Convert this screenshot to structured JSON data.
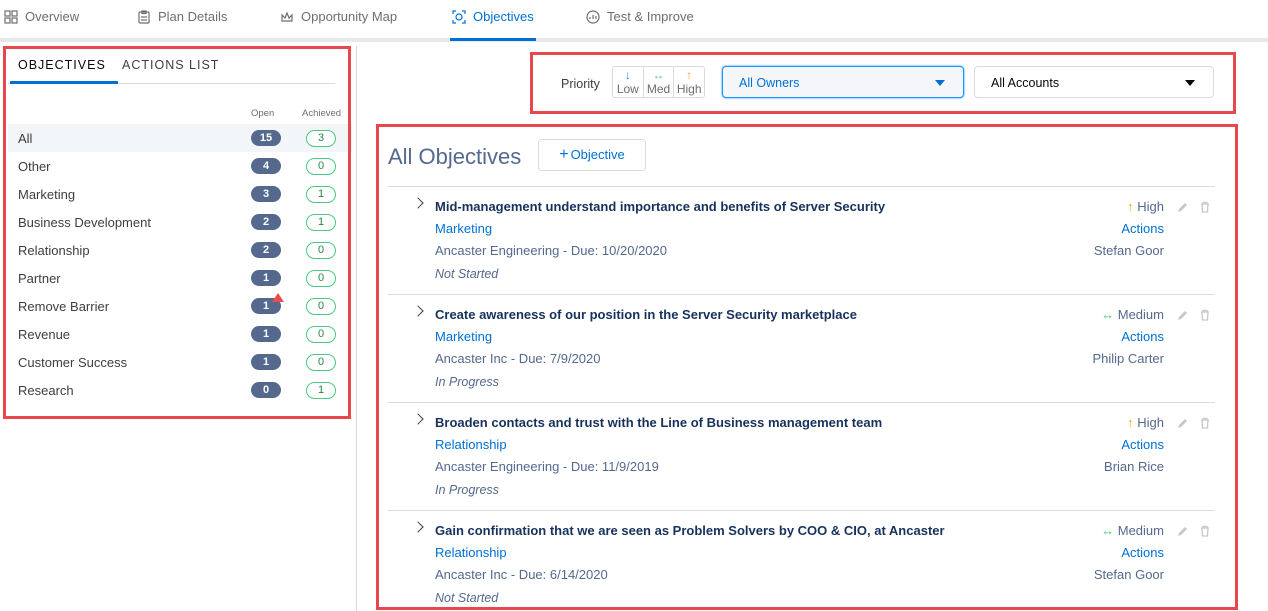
{
  "nav": {
    "tabs": [
      {
        "label": "Overview",
        "icon": "grid-icon"
      },
      {
        "label": "Plan Details",
        "icon": "clipboard-icon"
      },
      {
        "label": "Opportunity Map",
        "icon": "crown-icon"
      },
      {
        "label": "Objectives",
        "icon": "target-icon"
      },
      {
        "label": "Test & Improve",
        "icon": "gauge-icon"
      }
    ],
    "active_tab": "Objectives"
  },
  "sidebar": {
    "tabs": [
      "OBJECTIVES",
      "ACTIONS LIST"
    ],
    "active_tab": "OBJECTIVES",
    "col_open": "Open",
    "col_achieved": "Achieved",
    "categories": [
      {
        "label": "All",
        "open": "15",
        "achieved": "3"
      },
      {
        "label": "Other",
        "open": "4",
        "achieved": "0"
      },
      {
        "label": "Marketing",
        "open": "3",
        "achieved": "1"
      },
      {
        "label": "Business Development",
        "open": "2",
        "achieved": "1"
      },
      {
        "label": "Relationship",
        "open": "2",
        "achieved": "0"
      },
      {
        "label": "Partner",
        "open": "1",
        "achieved": "0"
      },
      {
        "label": "Remove Barrier",
        "open": "1",
        "achieved": "0",
        "warning": true
      },
      {
        "label": "Revenue",
        "open": "1",
        "achieved": "0"
      },
      {
        "label": "Customer Success",
        "open": "1",
        "achieved": "0"
      },
      {
        "label": "Research",
        "open": "0",
        "achieved": "1"
      }
    ],
    "selected": "All"
  },
  "filters": {
    "priority_label": "Priority",
    "priority_options": [
      {
        "arrow": "↓",
        "label": "Low",
        "color": "#1b96ff"
      },
      {
        "arrow": "↔",
        "label": "Med",
        "color": "#4bca81"
      },
      {
        "arrow": "↑",
        "label": "High",
        "color": "#f4a623"
      }
    ],
    "owner_value": "All Owners",
    "account_value": "All Accounts"
  },
  "main": {
    "title": "All Objectives",
    "add_button": "Objective",
    "objectives": [
      {
        "name": "Mid-management understand importance and benefits of Server Security",
        "category": "Marketing",
        "account_due": "Ancaster Engineering - Due: 10/20/2020",
        "status": "Not Started",
        "priority_arrow": "↑",
        "priority": "High",
        "actions": "Actions",
        "owner": "Stefan Goor"
      },
      {
        "name": "Create awareness of our position in the Server Security marketplace",
        "category": "Marketing",
        "account_due": "Ancaster Inc - Due: 7/9/2020",
        "status": "In Progress",
        "priority_arrow": "↔",
        "priority": "Medium",
        "actions": "Actions",
        "owner": "Philip Carter"
      },
      {
        "name": "Broaden contacts and trust with the Line of Business management team",
        "category": "Relationship",
        "account_due": "Ancaster Engineering - Due: 11/9/2019",
        "status": "In Progress",
        "priority_arrow": "↑",
        "priority": "High",
        "actions": "Actions",
        "owner": "Brian Rice"
      },
      {
        "name": "Gain confirmation that we are seen as Problem Solvers by COO & CIO, at Ancaster",
        "category": "Relationship",
        "account_due": "Ancaster Inc - Due: 6/14/2020",
        "status": "Not Started",
        "priority_arrow": "↔",
        "priority": "Medium",
        "actions": "Actions",
        "owner": "Stefan Goor"
      }
    ]
  },
  "colors": {
    "accent": "#0070d2",
    "highlight_box": "#e8474e",
    "badge_open": "#54698d",
    "badge_achieved": "#4bca81"
  }
}
